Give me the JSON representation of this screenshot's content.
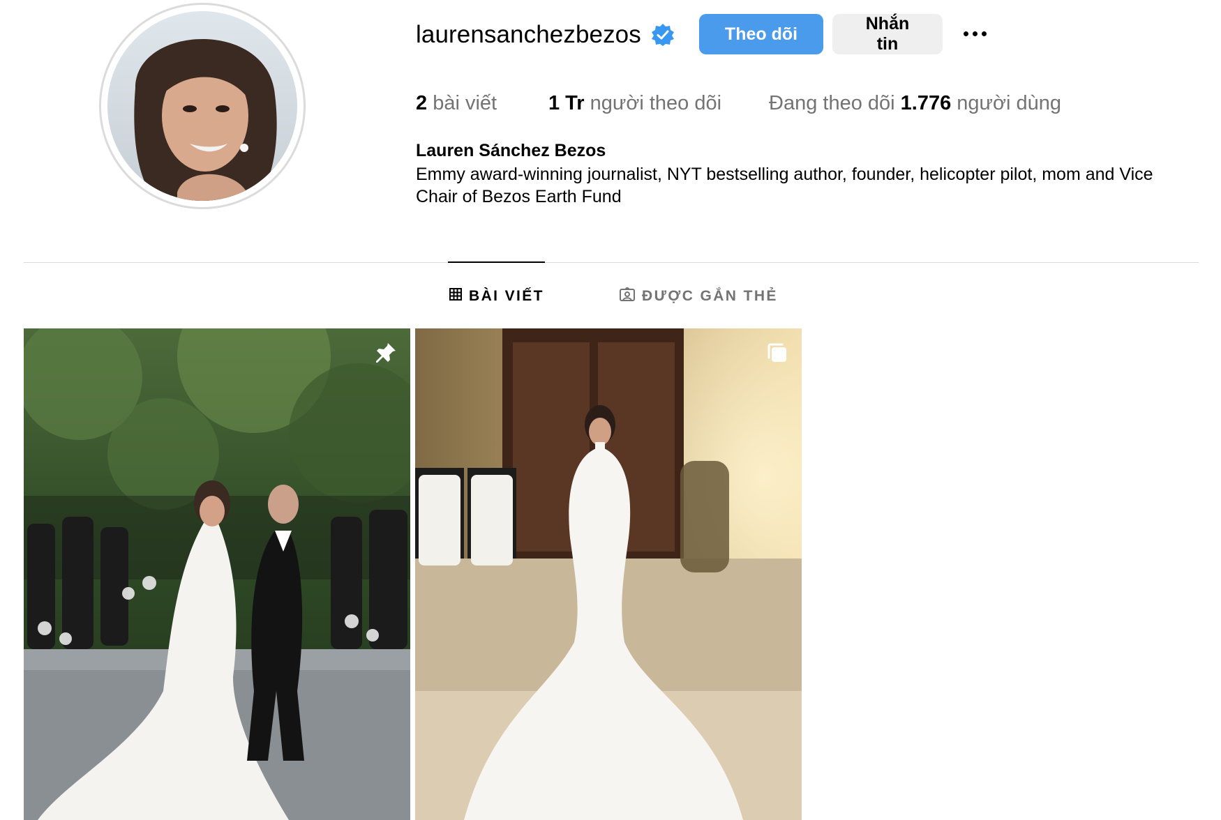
{
  "profile": {
    "username": "laurensanchezbezos",
    "verified_icon": "verified-badge-icon",
    "follow_label": "Theo dõi",
    "message_label": "Nhắn tin",
    "more_icon": "more-horizontal-icon",
    "stats": {
      "posts_count": "2",
      "posts_label": "bài viết",
      "followers_count": "1 Tr",
      "followers_label": "người theo dõi",
      "following_prefix": "Đang theo dõi",
      "following_count": "1.776",
      "following_suffix": "người dùng"
    },
    "full_name": "Lauren Sánchez Bezos",
    "bio": "Emmy award-winning journalist, NYT bestselling author, founder, helicopter pilot, mom and Vice Chair of Bezos Earth Fund"
  },
  "tabs": [
    {
      "label": "BÀI VIẾT",
      "icon": "grid-icon",
      "active": true
    },
    {
      "label": "ĐƯỢC GẮN THẺ",
      "icon": "tagged-person-icon",
      "active": false
    }
  ],
  "posts": [
    {
      "badge_icon": "pin-icon"
    },
    {
      "badge_icon": "carousel-icon"
    }
  ],
  "colors": {
    "accent": "#4a9bec",
    "secondary_button": "#efefef",
    "muted_text": "#737373",
    "divider": "#dbdbdb"
  }
}
